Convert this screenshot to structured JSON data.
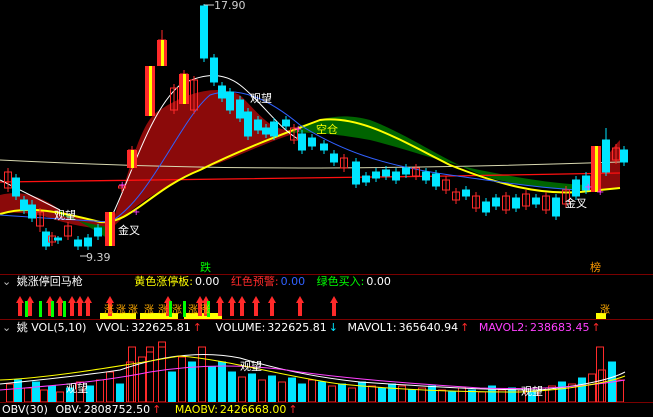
{
  "main": {
    "high_label": "17.90",
    "low_label": "9.39",
    "annotations": [
      {
        "text": "观望"
      },
      {
        "text": "观望"
      },
      {
        "text": "金叉"
      },
      {
        "text": "金叉"
      },
      {
        "text": "空仓"
      }
    ],
    "bottom_signals": [
      {
        "text": "跌"
      },
      {
        "text": "榜"
      }
    ],
    "colors": {
      "up_candle": "#ff2a2a",
      "down_candle": "#00e5ff",
      "red_fill": "#8b0a0a",
      "green_fill": "#006400",
      "yellow_line": "#ffff00",
      "blue_line": "#3060ff",
      "white_line": "#ffffff",
      "red_line": "#ff1010"
    }
  },
  "indicator1": {
    "title": "姚涨停回马枪",
    "items": [
      {
        "label": "黄色涨停板:",
        "value": "0.00",
        "color": "#ffff00"
      },
      {
        "label": "红色预警:",
        "value": "0.00",
        "color": "#ff2a2a"
      },
      {
        "label": "绿色买入:",
        "value": "0.00",
        "color": "#00ff00"
      }
    ],
    "value_color": "#3060ff",
    "tag_text": "涨"
  },
  "indicator2": {
    "title": "姚 VOL(5,10)",
    "items": [
      {
        "label": "VVOL:",
        "value": "322625.81",
        "arrow": "↑",
        "color": "#ffffff"
      },
      {
        "label": "VOLUME:",
        "value": "322625.81",
        "arrow": "↓",
        "color": "#ffffff"
      },
      {
        "label": "MAVOL1:",
        "value": "365640.94",
        "arrow": "↑",
        "color": "#ffffff"
      },
      {
        "label": "MAVOL2:",
        "value": "238683.45",
        "arrow": "↑",
        "color": "#ff40ff"
      }
    ],
    "annotations": [
      {
        "text": "观望"
      },
      {
        "text": "观望"
      },
      {
        "text": "观望"
      }
    ]
  },
  "indicator3": {
    "title": "OBV(30)",
    "items": [
      {
        "label": "OBV:",
        "value": "2808752.50",
        "arrow": "↑",
        "color": "#ffffff"
      },
      {
        "label": "MAOBV:",
        "value": "2426668.00",
        "arrow": "↑",
        "color": "#ffff00"
      }
    ]
  }
}
